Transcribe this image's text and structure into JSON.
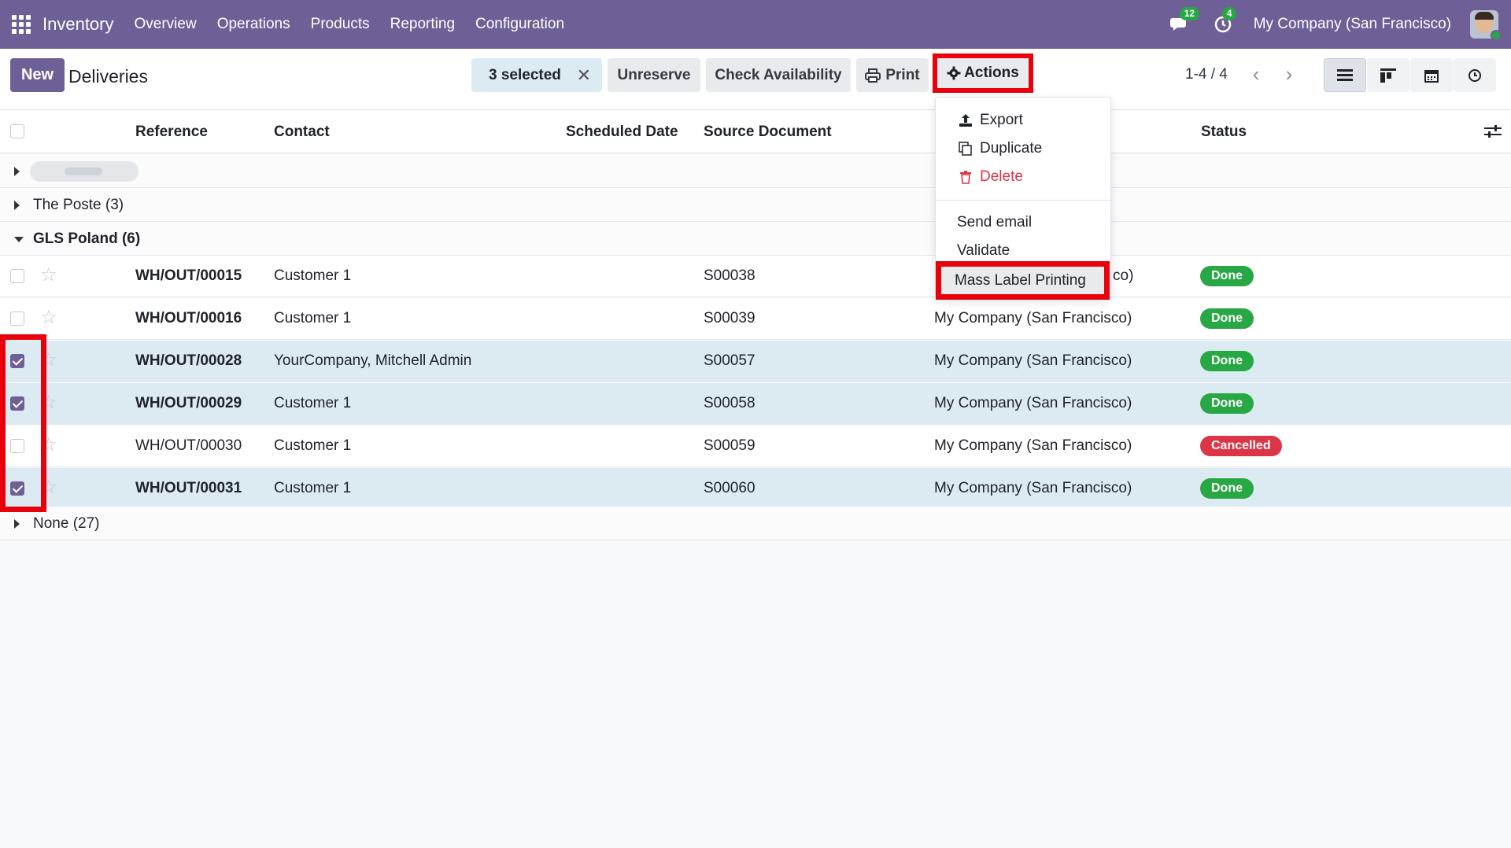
{
  "navbar": {
    "app_title": "Inventory",
    "menu": [
      "Overview",
      "Operations",
      "Products",
      "Reporting",
      "Configuration"
    ],
    "messages_count": "12",
    "activities_count": "4",
    "company": "My Company (San Francisco)"
  },
  "control": {
    "new_label": "New",
    "title": "Deliveries",
    "selected_label": "3 selected",
    "unreserve_label": "Unreserve",
    "check_availability_label": "Check Availability",
    "print_label": "Print",
    "actions_label": "Actions",
    "pager": "1-4 / 4"
  },
  "columns": {
    "reference": "Reference",
    "contact": "Contact",
    "scheduled_date": "Scheduled Date",
    "source_document": "Source Document",
    "status": "Status"
  },
  "groups": [
    {
      "label": "",
      "expanded": false
    },
    {
      "label": "The Poste (3)",
      "expanded": false
    },
    {
      "label": "GLS Poland (6)",
      "expanded": true
    },
    {
      "label": "None (27)",
      "expanded": false
    }
  ],
  "rows": [
    {
      "reference": "WH/OUT/00015",
      "contact": "Customer 1",
      "source": "S00038",
      "company": "co)",
      "status": "Done",
      "selected": false
    },
    {
      "reference": "WH/OUT/00016",
      "contact": "Customer 1",
      "source": "S00039",
      "company": "My Company (San Francisco)",
      "status": "Done",
      "selected": false
    },
    {
      "reference": "WH/OUT/00028",
      "contact": "YourCompany, Mitchell Admin",
      "source": "S00057",
      "company": "My Company (San Francisco)",
      "status": "Done",
      "selected": true
    },
    {
      "reference": "WH/OUT/00029",
      "contact": "Customer 1",
      "source": "S00058",
      "company": "My Company (San Francisco)",
      "status": "Done",
      "selected": true
    },
    {
      "reference": "WH/OUT/00030",
      "contact": "Customer 1",
      "source": "S00059",
      "company": "My Company (San Francisco)",
      "status": "Cancelled",
      "selected": false
    },
    {
      "reference": "WH/OUT/00031",
      "contact": "Customer 1",
      "source": "S00060",
      "company": "My Company (San Francisco)",
      "status": "Done",
      "selected": true
    }
  ],
  "actions_menu": {
    "export": "Export",
    "duplicate": "Duplicate",
    "delete": "Delete",
    "send_email": "Send email",
    "validate": "Validate",
    "mass_label_printing": "Mass Label Printing"
  },
  "colors": {
    "brand": "#6f5f97",
    "selected_row": "#dcebf2",
    "done": "#28a745",
    "cancelled": "#dc3545",
    "highlight": "#e8000c",
    "delete_text": "#dc3545"
  }
}
